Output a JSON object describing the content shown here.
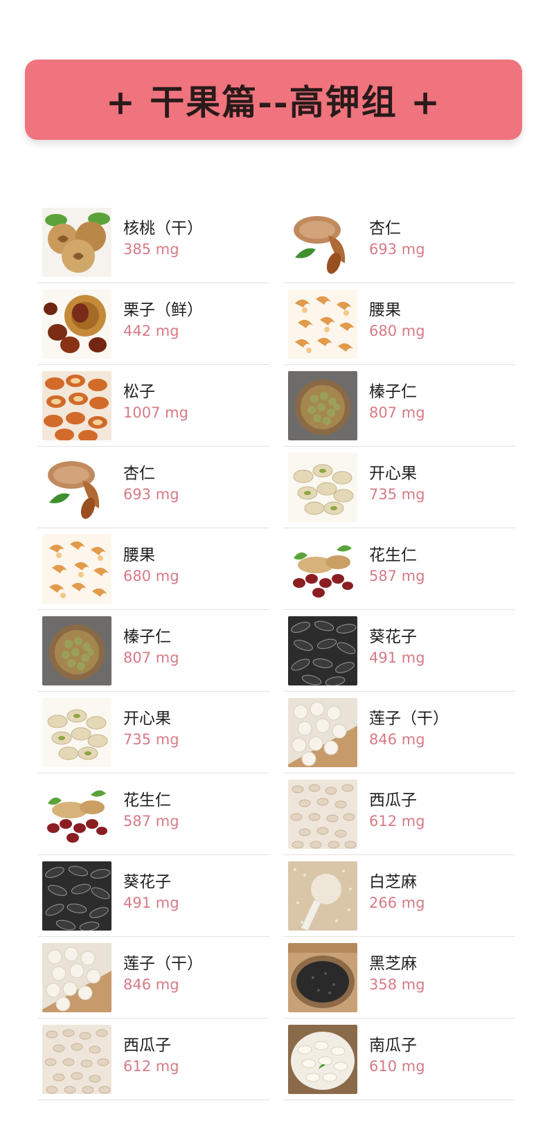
{
  "banner": {
    "title": "+ 干果篇--高钾组 +",
    "color": "#ef747e"
  },
  "colors": {
    "amount_text": "#d77a86",
    "name_text": "#1f1f1f",
    "divider": "#e2e2e2"
  },
  "left_column": [
    {
      "name": "核桃（干）",
      "amount": "385 mg",
      "icon": "walnut-icon"
    },
    {
      "name": "栗子（鲜）",
      "amount": "442 mg",
      "icon": "chestnut-icon"
    },
    {
      "name": "松子",
      "amount": "1007 mg",
      "icon": "pine-nut-icon"
    },
    {
      "name": "杏仁",
      "amount": "693 mg",
      "icon": "almond-icon"
    },
    {
      "name": "腰果",
      "amount": "680 mg",
      "icon": "cashew-icon"
    },
    {
      "name": "榛子仁",
      "amount": "807 mg",
      "icon": "hazelnut-icon"
    },
    {
      "name": "开心果",
      "amount": "735 mg",
      "icon": "pistachio-icon"
    },
    {
      "name": "花生仁",
      "amount": "587 mg",
      "icon": "peanut-icon"
    },
    {
      "name": "葵花子",
      "amount": "491 mg",
      "icon": "sunflower-seed-icon"
    },
    {
      "name": "莲子（干）",
      "amount": "846 mg",
      "icon": "lotus-seed-icon"
    },
    {
      "name": "西瓜子",
      "amount": "612 mg",
      "icon": "watermelon-seed-icon"
    }
  ],
  "right_column": [
    {
      "name": "杏仁",
      "amount": "693 mg",
      "icon": "almond-icon"
    },
    {
      "name": "腰果",
      "amount": "680 mg",
      "icon": "cashew-icon"
    },
    {
      "name": "榛子仁",
      "amount": "807 mg",
      "icon": "hazelnut-icon"
    },
    {
      "name": "开心果",
      "amount": "735 mg",
      "icon": "pistachio-icon"
    },
    {
      "name": "花生仁",
      "amount": "587 mg",
      "icon": "peanut-icon"
    },
    {
      "name": "葵花子",
      "amount": "491 mg",
      "icon": "sunflower-seed-icon"
    },
    {
      "name": "莲子（干）",
      "amount": "846 mg",
      "icon": "lotus-seed-icon"
    },
    {
      "name": "西瓜子",
      "amount": "612 mg",
      "icon": "watermelon-seed-icon"
    },
    {
      "name": "白芝麻",
      "amount": "266 mg",
      "icon": "white-sesame-icon"
    },
    {
      "name": "黑芝麻",
      "amount": "358 mg",
      "icon": "black-sesame-icon"
    },
    {
      "name": "南瓜子",
      "amount": "610 mg",
      "icon": "pumpkin-seed-icon"
    }
  ]
}
